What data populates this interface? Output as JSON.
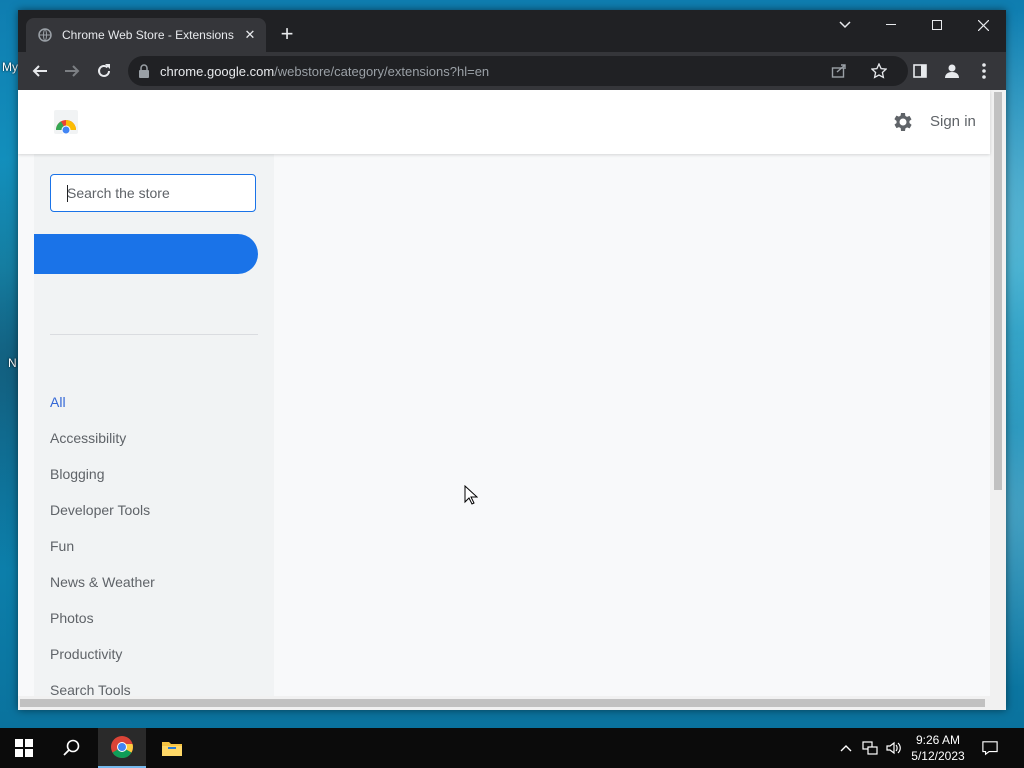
{
  "desktop": {
    "labels": [
      "My",
      "N"
    ]
  },
  "browser": {
    "tab": {
      "title": "Chrome Web Store - Extensions",
      "favicon": "globe-icon"
    },
    "address": {
      "host": "chrome.google.com",
      "path": "/webstore/category/extensions?hl=en"
    }
  },
  "store": {
    "sign_in": "Sign in",
    "search": {
      "placeholder": "Search the store",
      "value": ""
    },
    "categories": [
      "All",
      "Accessibility",
      "Blogging",
      "Developer Tools",
      "Fun",
      "News & Weather",
      "Photos",
      "Productivity",
      "Search Tools"
    ],
    "active_category": "All"
  },
  "taskbar": {
    "time": "9:26 AM",
    "date": "5/12/2023"
  },
  "colors": {
    "accent": "#1a73e8",
    "active_category": "#3367d6"
  }
}
